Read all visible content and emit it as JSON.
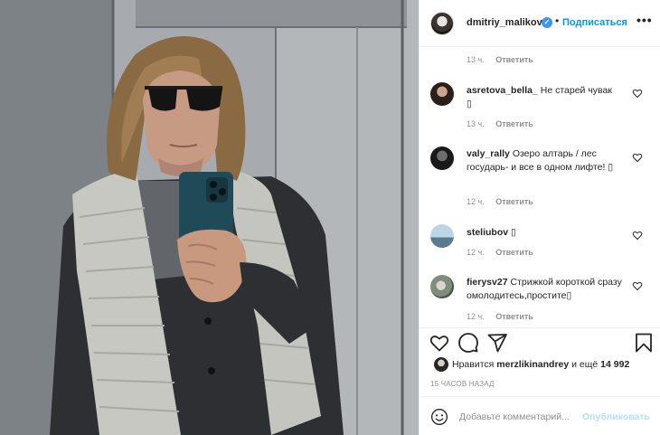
{
  "post": {
    "author": "dmitriy_malikov",
    "follow_label": "Подписаться",
    "dot": "•",
    "more": "•••"
  },
  "comments": [
    {
      "username": "",
      "text": "",
      "time": "13 ч.",
      "reply": "Ответить"
    },
    {
      "username": "asretova_bella_",
      "text": "Не старей чувак",
      "emoji": "▯",
      "time": "13 ч.",
      "reply": "Ответить"
    },
    {
      "username": "valy_rally",
      "text": "Озеро алтарь / лес государь- и все в одном лифте!",
      "emoji": "▯",
      "time": "12 ч.",
      "reply": "Ответить"
    },
    {
      "username": "steliubov",
      "text": "",
      "emoji": "▯",
      "time": "12 ч.",
      "reply": "Ответить"
    },
    {
      "username": "fierysv27",
      "text": "Стрижкой короткой сразу омолодитесь,простите",
      "emoji": "▯",
      "time": "12 ч.",
      "reply": "Ответить"
    }
  ],
  "likes": {
    "prefix": "Нравится",
    "user": "merzlikinandrey",
    "and_more": "и ещё",
    "count": "14 992"
  },
  "timestamp": "15 ЧАСОВ НАЗАД",
  "add_comment": {
    "placeholder": "Добавьте комментарий...",
    "publish_label": "Опубликовать"
  },
  "colors": {
    "accent": "#0095f6",
    "publish_disabled": "#b2dffc",
    "verified": "#3897f0",
    "muted": "#8e8e8e"
  },
  "icons": [
    "heart-icon",
    "comment-icon",
    "share-icon",
    "bookmark-icon",
    "emoji-icon",
    "verified-icon",
    "more-icon"
  ]
}
